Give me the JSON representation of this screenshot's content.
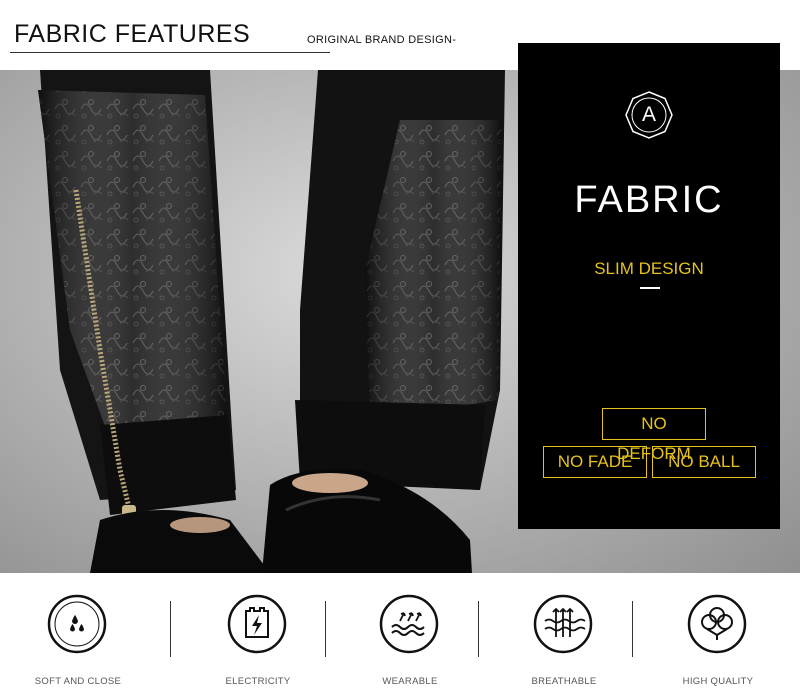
{
  "header": {
    "title": "FABRIC FEATURES",
    "subtitle": "ORIGINAL BRAND DESIGN-"
  },
  "panel": {
    "badge_letter": "A",
    "heading": "FABRIC",
    "subheading": "SLIM DESIGN",
    "tags": [
      "NO DEFORM",
      "NO FADE",
      "NO BALL"
    ],
    "accent_color": "#e6c21d"
  },
  "features": [
    {
      "label": "SOFT AND CLOSE",
      "icon": "water-drops-icon"
    },
    {
      "label": "ELECTRICITY",
      "icon": "lightning-shield-icon"
    },
    {
      "label": "WEARABLE",
      "icon": "waves-arrows-icon"
    },
    {
      "label": "BREATHABLE",
      "icon": "airflow-icon"
    },
    {
      "label": "HIGH QUALITY",
      "icon": "cotton-icon"
    }
  ]
}
